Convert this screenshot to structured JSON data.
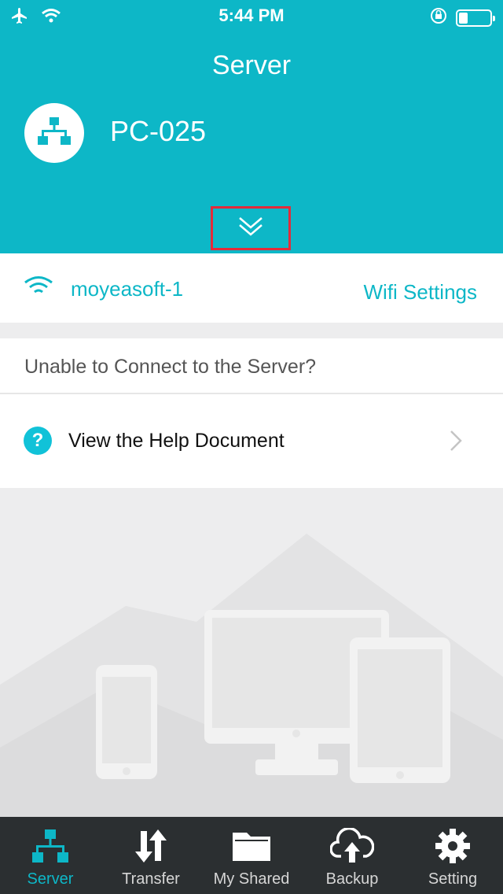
{
  "status_bar": {
    "time": "5:44 PM",
    "icons": [
      "airplane-icon",
      "wifi-icon",
      "rotation-lock-icon",
      "battery-icon"
    ],
    "battery_level": 0.3
  },
  "header": {
    "title": "Server",
    "server_name": "PC-025",
    "server_icon": "network-icon",
    "expand_icon": "double-chevron-down-icon"
  },
  "wifi": {
    "network_name": "moyeasoft-1",
    "settings_label": "Wifi Settings"
  },
  "help": {
    "question": "Unable to Connect to the Server?",
    "icon_glyph": "?",
    "link_label": "View the Help Document"
  },
  "tabs": [
    {
      "label": "Server",
      "icon": "network-icon",
      "active": true
    },
    {
      "label": "Transfer",
      "icon": "transfer-arrows-icon",
      "active": false
    },
    {
      "label": "My Shared",
      "icon": "folder-icon",
      "active": false
    },
    {
      "label": "Backup",
      "icon": "cloud-upload-icon",
      "active": false
    },
    {
      "label": "Setting",
      "icon": "gear-icon",
      "active": false
    }
  ],
  "colors": {
    "accent": "#0db7c7",
    "highlight_box": "#e32b3a",
    "tab_bar": "#2b2f31",
    "background": "#ededee"
  }
}
